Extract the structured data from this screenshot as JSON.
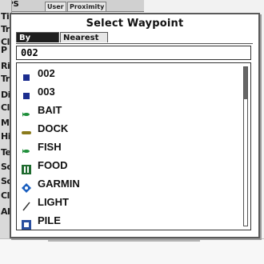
{
  "background": {
    "tab_gps": "GPS",
    "tabs": [
      "User",
      "Proximity"
    ],
    "left_items": [
      "Ti",
      "Tr",
      "Cl",
      "P",
      "Ri",
      "Tr",
      "Di",
      "Cl",
      "Mi",
      "Hi",
      "Te",
      "Sc",
      "Sc",
      "Cl",
      "Al"
    ]
  },
  "dialog": {
    "title": "Select Waypoint",
    "tabs": {
      "by_name": "By Name",
      "nearest": "Nearest"
    },
    "search_value": "002",
    "waypoints": [
      {
        "label": "002",
        "icon": "blue-square-icon",
        "color": "#1c2e8f"
      },
      {
        "label": "003",
        "icon": "blue-square-icon",
        "color": "#1c2e8f"
      },
      {
        "label": "BAIT",
        "icon": "fish-icon",
        "color": "#1f8f3a"
      },
      {
        "label": "DOCK",
        "icon": "dock-icon",
        "color": "#8a7a1c"
      },
      {
        "label": "FISH",
        "icon": "fish-icon",
        "color": "#1f8f3a"
      },
      {
        "label": "FOOD",
        "icon": "food-icon",
        "color": "#1f6b2f"
      },
      {
        "label": "GARMIN",
        "icon": "garmin-icon",
        "color": "#1a5fbf"
      },
      {
        "label": "LIGHT",
        "icon": "light-icon",
        "color": "#333333"
      },
      {
        "label": "PILE",
        "icon": "pile-icon",
        "color": "#2a4fa0"
      }
    ]
  },
  "scroll_position": 0
}
